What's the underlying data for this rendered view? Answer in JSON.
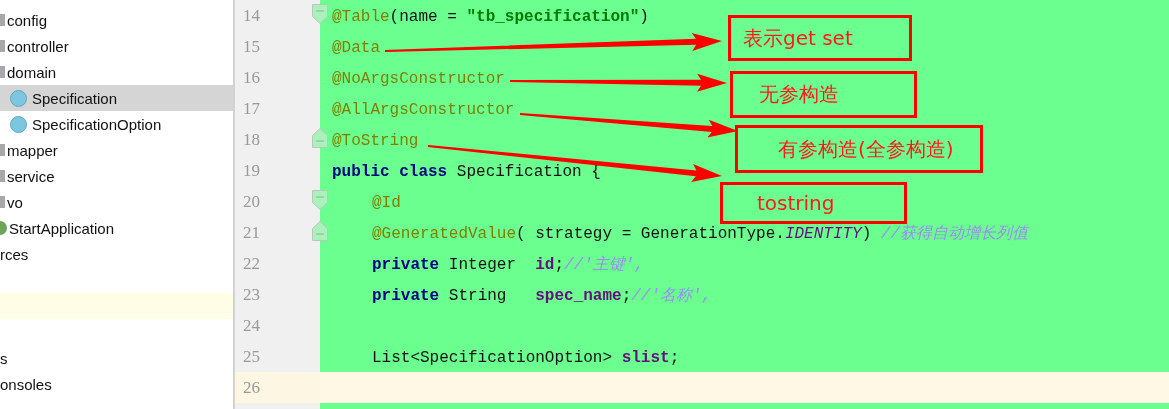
{
  "project_tree": {
    "items": [
      {
        "kind": "folder",
        "label": "config",
        "selected": false
      },
      {
        "kind": "folder",
        "label": "controller",
        "selected": false
      },
      {
        "kind": "folder",
        "label": "domain",
        "selected": false
      },
      {
        "kind": "class",
        "label": "Specification",
        "selected": true
      },
      {
        "kind": "class",
        "label": "SpecificationOption",
        "selected": false
      },
      {
        "kind": "folder",
        "label": "mapper",
        "selected": false
      },
      {
        "kind": "folder",
        "label": "service",
        "selected": false
      },
      {
        "kind": "folder",
        "label": "vo",
        "selected": false
      },
      {
        "kind": "app",
        "label": "StartApplication",
        "selected": false
      },
      {
        "kind": "plain",
        "label": "rces",
        "selected": false
      },
      {
        "kind": "blank",
        "highlighted": false
      },
      {
        "kind": "blank",
        "highlighted": true
      },
      {
        "kind": "blank",
        "highlighted": false
      },
      {
        "kind": "plain",
        "label": "s",
        "selected": false
      },
      {
        "kind": "plain",
        "label": "onsoles",
        "selected": false
      }
    ]
  },
  "editor": {
    "lines": [
      {
        "number": "14",
        "kind": "opener",
        "current": false,
        "indented": false,
        "tokens": [
          {
            "kind": "annotation",
            "text": "@Table"
          },
          {
            "kind": "plain",
            "text": "(name = "
          },
          {
            "kind": "string",
            "text": "\"tb_specification\""
          },
          {
            "kind": "plain",
            "text": ")"
          }
        ]
      },
      {
        "number": "15",
        "current": false,
        "indented": false,
        "tokens": [
          {
            "kind": "annotation",
            "text": "@Data"
          }
        ]
      },
      {
        "number": "16",
        "current": false,
        "indented": false,
        "tokens": [
          {
            "kind": "annotation",
            "text": "@NoArgsConstructor"
          }
        ]
      },
      {
        "number": "17",
        "current": false,
        "indented": false,
        "tokens": [
          {
            "kind": "annotation",
            "text": "@AllArgsConstructor"
          }
        ]
      },
      {
        "number": "18",
        "kind": "closer",
        "current": false,
        "indented": false,
        "tokens": [
          {
            "kind": "annotation",
            "text": "@ToString"
          }
        ]
      },
      {
        "number": "19",
        "current": false,
        "indented": false,
        "tokens": [
          {
            "kind": "keyword",
            "text": "public class"
          },
          {
            "kind": "plain",
            "text": " Specification {"
          }
        ]
      },
      {
        "number": "20",
        "kind": "opener",
        "current": false,
        "indented": true,
        "tokens": [
          {
            "kind": "annotation",
            "text": "@Id"
          }
        ]
      },
      {
        "number": "21",
        "kind": "closer",
        "current": false,
        "indented": true,
        "tokens": [
          {
            "kind": "annotation",
            "text": "@GeneratedValue"
          },
          {
            "kind": "plain",
            "text": "( strategy = GenerationType."
          },
          {
            "kind": "constant",
            "text": "IDENTITY"
          },
          {
            "kind": "plain",
            "text": ") "
          },
          {
            "kind": "comment",
            "text": "//获得自动增长列值"
          }
        ]
      },
      {
        "number": "22",
        "current": false,
        "indented": true,
        "tokens": [
          {
            "kind": "keyword",
            "text": "private"
          },
          {
            "kind": "plain",
            "text": " Integer  "
          },
          {
            "kind": "field",
            "text": "id"
          },
          {
            "kind": "plain",
            "text": ";"
          },
          {
            "kind": "comment",
            "text": "//'主键',"
          }
        ]
      },
      {
        "number": "23",
        "current": false,
        "indented": true,
        "tokens": [
          {
            "kind": "keyword",
            "text": "private"
          },
          {
            "kind": "plain",
            "text": " String   "
          },
          {
            "kind": "field",
            "text": "spec_name"
          },
          {
            "kind": "plain",
            "text": ";"
          },
          {
            "kind": "comment",
            "text": "//'名称',"
          }
        ]
      },
      {
        "number": "24",
        "current": false
      },
      {
        "number": "25",
        "current": false,
        "indented": true,
        "tokens": [
          {
            "kind": "plain",
            "text": "List<SpecificationOption> "
          },
          {
            "kind": "field",
            "text": "slist"
          },
          {
            "kind": "plain",
            "text": ";"
          }
        ]
      },
      {
        "number": "26",
        "current": true
      }
    ]
  },
  "callouts": [
    {
      "text": "表示get set"
    },
    {
      "text": "无参构造"
    },
    {
      "text": "有参构造(全参构造)"
    },
    {
      "text": "tostring"
    }
  ]
}
